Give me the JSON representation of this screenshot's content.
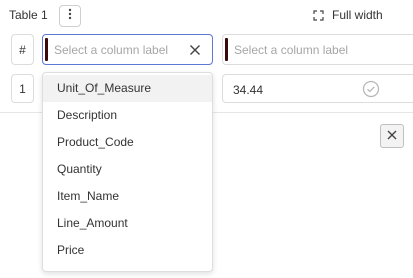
{
  "header": {
    "table_title": "Table 1",
    "full_width_label": "Full width"
  },
  "table": {
    "hash_label": "#",
    "row_number": "1",
    "column_select_placeholder": "Select a column label",
    "column2_placeholder": "Select a column label",
    "cell_value": "34.44"
  },
  "dropdown": {
    "options": [
      "Unit_Of_Measure",
      "Description",
      "Product_Code",
      "Quantity",
      "Item_Name",
      "Line_Amount",
      "Price"
    ],
    "highlighted_index": 0
  },
  "colors": {
    "accent_border": "#5d78d6",
    "column_marker": "#3a0a0a"
  },
  "icons": {
    "more": "more-vertical-icon",
    "full_width": "expand-icon",
    "clear": "close-icon",
    "valid": "check-circle-icon",
    "close_panel": "close-icon"
  }
}
